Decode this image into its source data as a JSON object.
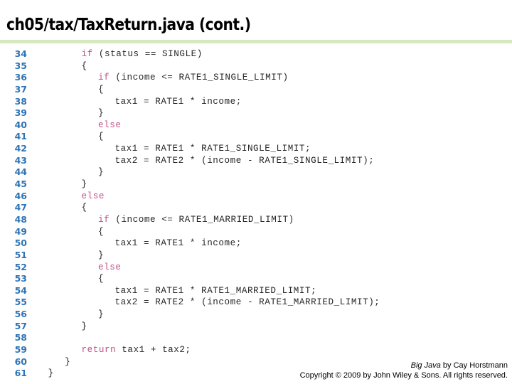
{
  "slide": {
    "title": "ch05/tax/TaxReturn.java (cont.)",
    "accent_rule_color": "#d5e8c0",
    "line_number_color": "#2e74b5",
    "keyword_color": "#c0508a",
    "code_color": "#262626"
  },
  "code": {
    "lines": [
      {
        "number": "34",
        "indent": 8,
        "keyword": "if",
        "text": " (status == SINGLE)"
      },
      {
        "number": "35",
        "indent": 8,
        "keyword": "",
        "text": "{"
      },
      {
        "number": "36",
        "indent": 11,
        "keyword": "if",
        "text": " (income <= RATE1_SINGLE_LIMIT)"
      },
      {
        "number": "37",
        "indent": 11,
        "keyword": "",
        "text": "{"
      },
      {
        "number": "38",
        "indent": 14,
        "keyword": "",
        "text": "tax1 = RATE1 * income;"
      },
      {
        "number": "39",
        "indent": 11,
        "keyword": "",
        "text": "}"
      },
      {
        "number": "40",
        "indent": 11,
        "keyword": "else",
        "text": ""
      },
      {
        "number": "41",
        "indent": 11,
        "keyword": "",
        "text": "{"
      },
      {
        "number": "42",
        "indent": 14,
        "keyword": "",
        "text": "tax1 = RATE1 * RATE1_SINGLE_LIMIT;"
      },
      {
        "number": "43",
        "indent": 14,
        "keyword": "",
        "text": "tax2 = RATE2 * (income - RATE1_SINGLE_LIMIT);"
      },
      {
        "number": "44",
        "indent": 11,
        "keyword": "",
        "text": "}"
      },
      {
        "number": "45",
        "indent": 8,
        "keyword": "",
        "text": "}"
      },
      {
        "number": "46",
        "indent": 8,
        "keyword": "else",
        "text": ""
      },
      {
        "number": "47",
        "indent": 8,
        "keyword": "",
        "text": "{"
      },
      {
        "number": "48",
        "indent": 11,
        "keyword": "if",
        "text": " (income <= RATE1_MARRIED_LIMIT)"
      },
      {
        "number": "49",
        "indent": 11,
        "keyword": "",
        "text": "{"
      },
      {
        "number": "50",
        "indent": 14,
        "keyword": "",
        "text": "tax1 = RATE1 * income;"
      },
      {
        "number": "51",
        "indent": 11,
        "keyword": "",
        "text": "}"
      },
      {
        "number": "52",
        "indent": 11,
        "keyword": "else",
        "text": ""
      },
      {
        "number": "53",
        "indent": 11,
        "keyword": "",
        "text": "{"
      },
      {
        "number": "54",
        "indent": 14,
        "keyword": "",
        "text": "tax1 = RATE1 * RATE1_MARRIED_LIMIT;"
      },
      {
        "number": "55",
        "indent": 14,
        "keyword": "",
        "text": "tax2 = RATE2 * (income - RATE1_MARRIED_LIMIT);"
      },
      {
        "number": "56",
        "indent": 11,
        "keyword": "",
        "text": "}"
      },
      {
        "number": "57",
        "indent": 8,
        "keyword": "",
        "text": "}"
      },
      {
        "number": "58",
        "indent": 0,
        "keyword": "",
        "text": ""
      },
      {
        "number": "59",
        "indent": 8,
        "keyword": "return",
        "text": " tax1 + tax2;"
      },
      {
        "number": "60",
        "indent": 5,
        "keyword": "",
        "text": "}"
      },
      {
        "number": "61",
        "indent": 2,
        "keyword": "",
        "text": "}"
      }
    ]
  },
  "footer": {
    "book_title": "Big Java",
    "attribution": " by Cay Horstmann",
    "copyright": "Copyright © 2009 by John Wiley & Sons.  All rights reserved."
  }
}
